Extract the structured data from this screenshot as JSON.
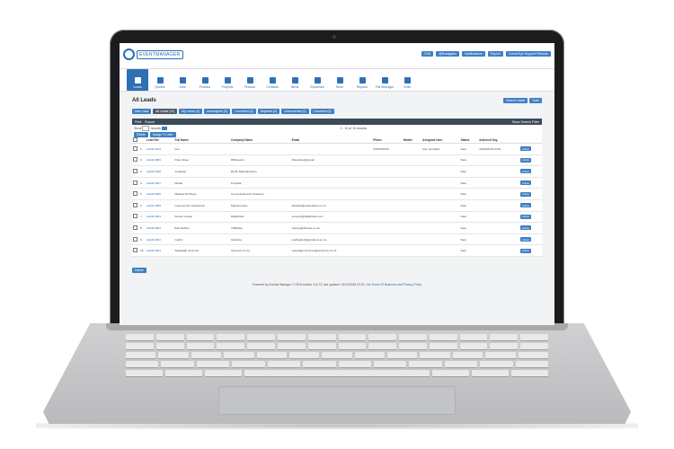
{
  "app": {
    "logo_text": "EVENTMANAGER"
  },
  "top_actions": [
    "CNS",
    "@Bradgalus",
    "Notifications",
    "Payroll",
    "CornerEye Support Remote"
  ],
  "nav": [
    {
      "label": "Leads",
      "active": true
    },
    {
      "label": "Quotes",
      "active": false
    },
    {
      "label": "Jobs",
      "active": false
    },
    {
      "label": "Finance",
      "active": false
    },
    {
      "label": "Projects",
      "active": false
    },
    {
      "label": "Finance",
      "active": false
    },
    {
      "label": "Contacts",
      "active": false
    },
    {
      "label": "Items",
      "active": false
    },
    {
      "label": "Expenses",
      "active": false
    },
    {
      "label": "More",
      "active": false
    },
    {
      "label": "Reports",
      "active": false
    },
    {
      "label": "File Manager",
      "active": false
    },
    {
      "label": "Tools",
      "active": false
    }
  ],
  "page": {
    "title": "All Leads",
    "head_buttons": [
      "Search Leads",
      "Tools"
    ],
    "new_lead": "New Lead",
    "filters": [
      "All Leads (12)",
      "My Leads (0)",
      "Unassigned (0)",
      "Converted (0)",
      "Rejected (0)",
      "Unconverted (0)",
      "Cancelled (0)"
    ],
    "toolbar_left": [
      "Print",
      "Export"
    ],
    "toolbar_right": "Show Search Filter",
    "show_label": "Show",
    "show_value": "10",
    "records_label": "records",
    "records_summary": "1 - 10 of 10 records",
    "bulk_buttons": [
      "Delete",
      "Assign To User"
    ],
    "columns": [
      "Lead Ref.",
      "Full Name",
      "Company Name",
      "Email",
      "Phone",
      "Mobile",
      "Assigned User",
      "Status",
      "Actioned Org."
    ],
    "rows": [
      {
        "num": "1.",
        "ref": "LEAD-0010",
        "name": "test",
        "company": "",
        "email": "",
        "phone": "0470042649",
        "mobile": "",
        "user": "Ivan Gonzalez",
        "status": "New",
        "date": "16/10/2018 16:20",
        "action": "Action"
      },
      {
        "num": "2.",
        "ref": "LEAD-0009",
        "name": "Peter Dove",
        "company": "DB Events",
        "email": "Peterdove@gmail",
        "phone": "",
        "mobile": "",
        "user": "",
        "status": "New",
        "date": "",
        "action": "Action"
      },
      {
        "num": "3.",
        "ref": "LEAD-0008",
        "name": "Jonathan",
        "company": "RCSL Manufacturers",
        "email": "",
        "phone": "",
        "mobile": "",
        "user": "",
        "status": "New",
        "date": "",
        "action": "Action"
      },
      {
        "num": "4.",
        "ref": "LEAD-0007",
        "name": "Mehar",
        "company": "Propella",
        "email": "",
        "phone": "",
        "mobile": "",
        "user": "",
        "status": "New",
        "date": "",
        "action": "Action"
      },
      {
        "num": "5.",
        "ref": "LEAD-0006",
        "name": "Melissa De Bruyn",
        "company": "Concentrated Air Solutions",
        "email": "",
        "phone": "",
        "mobile": "",
        "user": "",
        "status": "New",
        "date": "",
        "action": "Action"
      },
      {
        "num": "6.",
        "ref": "LEAD-0005",
        "name": "Lara van der westhuizen",
        "company": "MasterCooks",
        "email": "laravdw@masterkoks.co.za",
        "phone": "",
        "mobile": "",
        "user": "",
        "status": "New",
        "date": "",
        "action": "Action"
      },
      {
        "num": "7.",
        "ref": "LEAD-0004",
        "name": "Suzan Cooper",
        "company": "Digithinkle",
        "email": "scooper@digithinkle.com",
        "phone": "",
        "mobile": "",
        "user": "",
        "status": "New",
        "date": "",
        "action": "Action"
      },
      {
        "num": "8.",
        "ref": "LEAD-0003",
        "name": "Bob Rathes",
        "company": "VillMedia",
        "email": "rbahes@villmwe.co.za",
        "phone": "",
        "mobile": "",
        "user": "",
        "status": "New",
        "date": "",
        "action": "Action"
      },
      {
        "num": "9.",
        "ref": "LEAD-0002",
        "name": "Cedric",
        "company": "GtAdvns",
        "email": "cedricgimsl@gtmdnns.co.za",
        "phone": "",
        "mobile": "",
        "user": "",
        "status": "New",
        "date": "",
        "action": "Action"
      },
      {
        "num": "10.",
        "ref": "LEAD-0001",
        "name": "Salvatagh Simmner",
        "company": "Simmnce & Co.",
        "email": "salvatagh.simmner@simmnce.co.za",
        "phone": "",
        "mobile": "",
        "user": "",
        "status": "New",
        "date": "",
        "action": "Action"
      }
    ],
    "bottom_button": "Delete",
    "footer_text": "Powered by Eventsi Manager © 2018 version: 6.4.73, last updated: 16/10/2018 21:23. Our",
    "footer_terms": "Terms Of Business",
    "footer_and": "and",
    "footer_privacy": "Privacy Policy"
  }
}
